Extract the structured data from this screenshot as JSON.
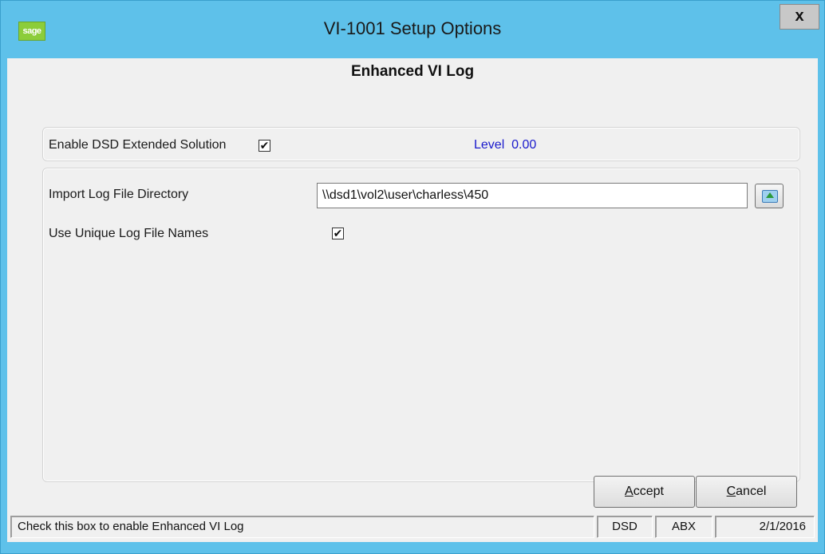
{
  "window": {
    "title": "VI-1001 Setup Options",
    "logo_text": "sage",
    "close_label": "x"
  },
  "heading": "Enhanced VI Log",
  "extended_solution": {
    "label": "Enable DSD Extended Solution",
    "checked": true,
    "level_label": "Level",
    "level_value": "0.00"
  },
  "fields": {
    "import_dir_label": "Import Log File Directory",
    "import_dir_value": "\\\\dsd1\\vol2\\user\\charless\\450",
    "unique_names_label": "Use Unique Log File Names",
    "unique_names_checked": true
  },
  "buttons": {
    "accept_hotkey": "A",
    "accept_rest": "ccept",
    "cancel_hotkey": "C",
    "cancel_rest": "ancel"
  },
  "status": {
    "message": "Check this box to enable Enhanced VI Log",
    "company": "DSD",
    "user": "ABX",
    "date": "2/1/2016"
  },
  "icons": {
    "check_glyph": "✔"
  },
  "colors": {
    "titlebar": "#5ec1ea",
    "level_text": "#1a1acc",
    "logo": "#8ccd3a"
  }
}
